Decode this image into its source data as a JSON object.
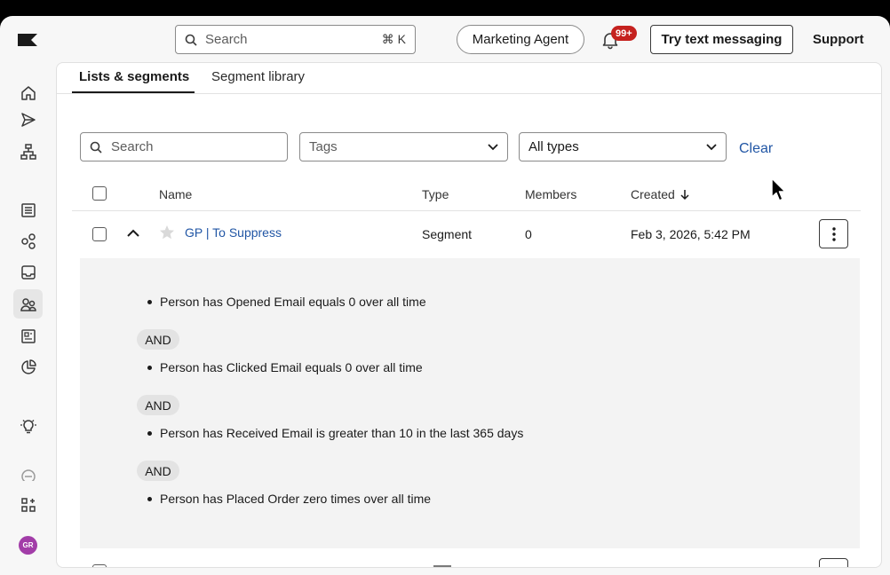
{
  "topbar": {
    "search_placeholder": "Search",
    "search_shortcut": "⌘ K",
    "agent_label": "Marketing Agent",
    "notification_count": "99+",
    "sms_label": "Try text messaging",
    "support_label": "Support"
  },
  "sidebar": {
    "items": [
      {
        "icon": "home-icon"
      },
      {
        "icon": "send-icon"
      },
      {
        "icon": "flow-icon"
      },
      {
        "icon": "list-icon"
      },
      {
        "icon": "network-icon"
      },
      {
        "icon": "inbox-icon"
      },
      {
        "icon": "audience-icon",
        "active": true
      },
      {
        "icon": "content-icon"
      },
      {
        "icon": "analytics-icon"
      },
      {
        "icon": "lightbulb-icon"
      },
      {
        "icon": "apps-icon"
      }
    ],
    "avatar_initials": "GR"
  },
  "tabs": [
    {
      "label": "Lists & segments",
      "active": true
    },
    {
      "label": "Segment library",
      "active": false
    }
  ],
  "filters": {
    "search_placeholder": "Search",
    "tags_placeholder": "Tags",
    "type_value": "All types",
    "clear_label": "Clear"
  },
  "table": {
    "headers": {
      "name": "Name",
      "type": "Type",
      "members": "Members",
      "created": "Created"
    },
    "rows": [
      {
        "name": "GP | To Suppress",
        "type": "Segment",
        "members": "0",
        "created": "Feb 3, 2026, 5:42 PM",
        "conditions": [
          "Person has Opened Email equals 0 over all time",
          "Person has Clicked Email equals 0 over all time",
          "Person has Received Email is greater than 10 in the last 365 days",
          "Person has Placed Order zero times over all time"
        ],
        "joiner": "AND"
      }
    ]
  },
  "colors": {
    "link": "#2156a5",
    "badge": "#c5221f",
    "avatar": "#a23da8"
  }
}
